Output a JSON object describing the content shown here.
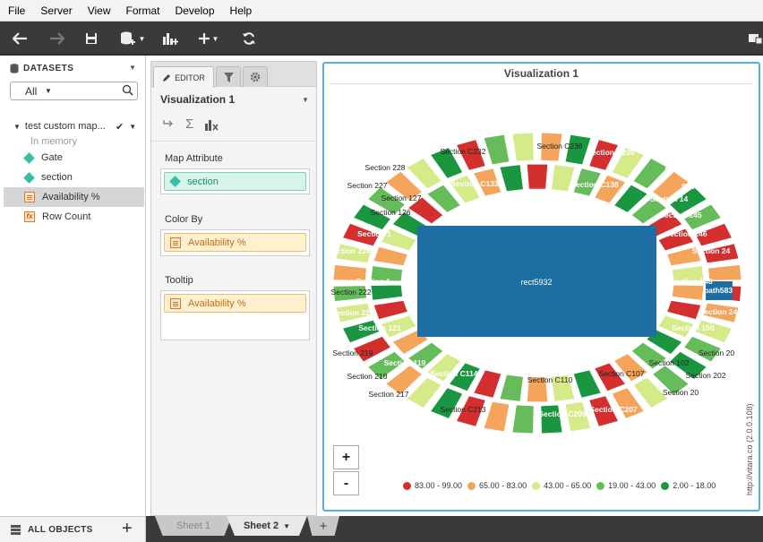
{
  "menu": [
    "File",
    "Server",
    "View",
    "Format",
    "Develop",
    "Help"
  ],
  "toolbar": {
    "icons": [
      "back-arrow-icon",
      "forward-arrow-icon",
      "save-icon",
      "add-data-icon",
      "add-chart-icon",
      "add-icon",
      "refresh-icon",
      "present-icon"
    ]
  },
  "datasets": {
    "header": "DATASETS",
    "filter": "All",
    "dataset_name": "test custom map...",
    "dataset_note": "In memory",
    "items": [
      {
        "label": "Gate",
        "kind": "dimension"
      },
      {
        "label": "section",
        "kind": "dimension"
      },
      {
        "label": "Availability %",
        "kind": "measure"
      },
      {
        "label": "Row Count",
        "kind": "formula"
      }
    ],
    "all_objects": "ALL OBJECTS"
  },
  "sheets": {
    "tabs": [
      "Sheet 1",
      "Sheet 2"
    ],
    "add": "+"
  },
  "editor": {
    "tab_label": "EDITOR",
    "viz_name": "Visualization 1",
    "map_attribute_label": "Map Attribute",
    "map_attribute_value": "section",
    "color_by_label": "Color By",
    "color_by_value": "Availability %",
    "tooltip_label": "Tooltip",
    "tooltip_value": "Availability %"
  },
  "viz": {
    "title": "Visualization 1",
    "center_label": "rect5932",
    "zoom_in": "+",
    "zoom_out": "-",
    "credit": "http://vitara.co (2.0.0.108)",
    "section_labels": [
      "Section C232",
      "Section C236",
      "Section C238",
      "Section 242",
      "Section 228",
      "Section C133",
      "Section C138",
      "Section 24",
      "Section 227",
      "Section 127",
      "Section 14",
      "Section 126",
      "Section 145",
      "Section 1",
      "Section 146",
      "Section 224",
      "Section 24",
      "Section 1",
      "Section 148",
      "Section 222",
      "path583",
      "Section 221",
      "Section 24",
      "Section 121",
      "Section 150",
      "Section 219",
      "Section 20",
      "Section 119",
      "Section C114",
      "Section C107",
      "Section 102",
      "Section 218",
      "Section C110",
      "Section 202",
      "Section 217",
      "Section 20",
      "Section C213",
      "Section C209",
      "Section C207"
    ],
    "legend": [
      {
        "label": "83.00 - 99.00",
        "color": "#d32f2f"
      },
      {
        "label": "65.00 - 83.00",
        "color": "#f4a45b"
      },
      {
        "label": "43.00 - 65.00",
        "color": "#d6ea8a"
      },
      {
        "label": "19.00 - 43.00",
        "color": "#66bb5a"
      },
      {
        "label": "2.00 - 18.00",
        "color": "#1a9641"
      }
    ]
  }
}
